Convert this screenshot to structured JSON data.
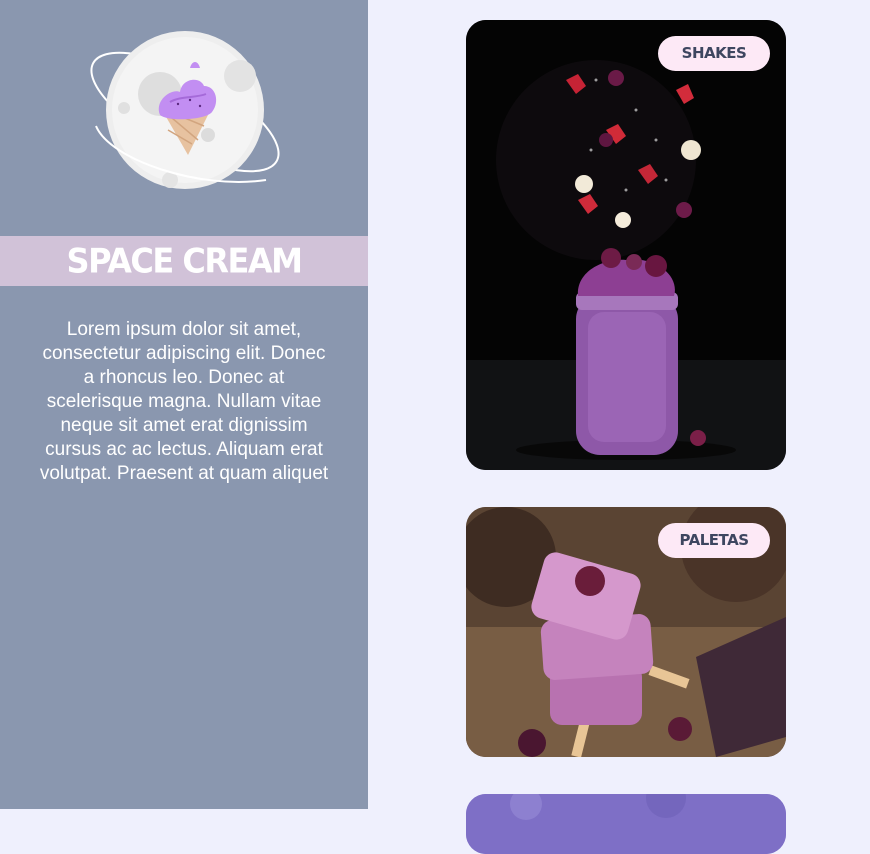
{
  "brand": {
    "title": "SPACE CREAM",
    "logo_icon": "ice-cream-planet-icon"
  },
  "description": "Lorem ipsum dolor sit amet, consectetur adipiscing elit. Donec a rhoncus leo. Donec at scelerisque magna. Nullam vitae neque sit amet erat dignissim cursus ac ac lectus. Aliquam erat volutpat. Praesent at quam aliquet",
  "cards": [
    {
      "label": "SHAKES"
    },
    {
      "label": "PALETAS"
    },
    {
      "label": ""
    }
  ],
  "colors": {
    "sidebar": "#8a97af",
    "brand_band": "#d1c2d8",
    "page_background": "#eff0fd",
    "badge_background": "#fde9f6",
    "badge_text": "#3e4660"
  }
}
